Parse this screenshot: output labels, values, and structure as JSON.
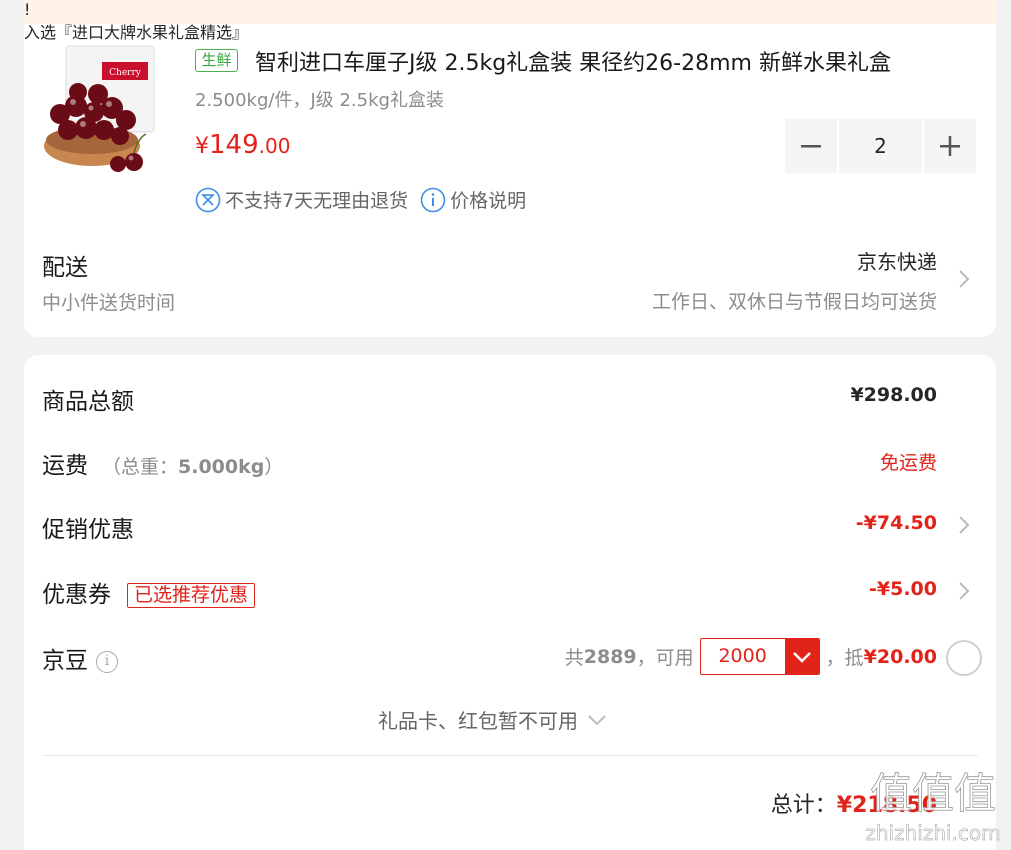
{
  "banner": {
    "text": "入选『进口大牌水果礼盒精选』"
  },
  "product": {
    "tag": "生鲜",
    "title": "智利进口车厘子J级 2.5kg礼盒装 果径约26-28mm 新鲜水果礼盒",
    "spec": "2.500kg/件，J级 2.5kg礼盒装",
    "price_currency": "¥",
    "price_int": "149",
    "price_dec": ".00",
    "quantity": "2",
    "policy_return": "不支持7天无理由退货",
    "policy_price": "价格说明"
  },
  "shipping": {
    "label": "配送",
    "sub": "中小件送货时间",
    "method": "京东快递",
    "time": "工作日、双休日与节假日均可送货"
  },
  "summary": {
    "goods_total_label": "商品总额",
    "goods_total_value": "¥298.00",
    "freight_label": "运费",
    "freight_note_prefix": "（总重：",
    "freight_weight": "5.000kg",
    "freight_note_suffix": "）",
    "freight_value": "免运费",
    "promo_label": "促销优惠",
    "promo_value": "-¥74.50",
    "coupon_label": "优惠券",
    "coupon_tag": "已选推荐优惠",
    "coupon_value": "-¥5.00",
    "bean_label": "京豆",
    "bean_info": "i",
    "bean_total_prefix": "共",
    "bean_total": "2889",
    "bean_usable_label": "，可用",
    "bean_selected": "2000",
    "bean_deduct_label": "，抵",
    "bean_deduct_value": "¥20.00",
    "gift_note": "礼品卡、红包暂不可用",
    "total_label": "总计：",
    "total_value": "¥218.50"
  },
  "watermark": {
    "text": "值值值",
    "sub": "zhizhizhi.com"
  },
  "colors": {
    "accent": "#e2231a",
    "fresh_green": "#3aa63e",
    "muted": "#8c8c8c",
    "banner_bg": "#fff2e6"
  }
}
